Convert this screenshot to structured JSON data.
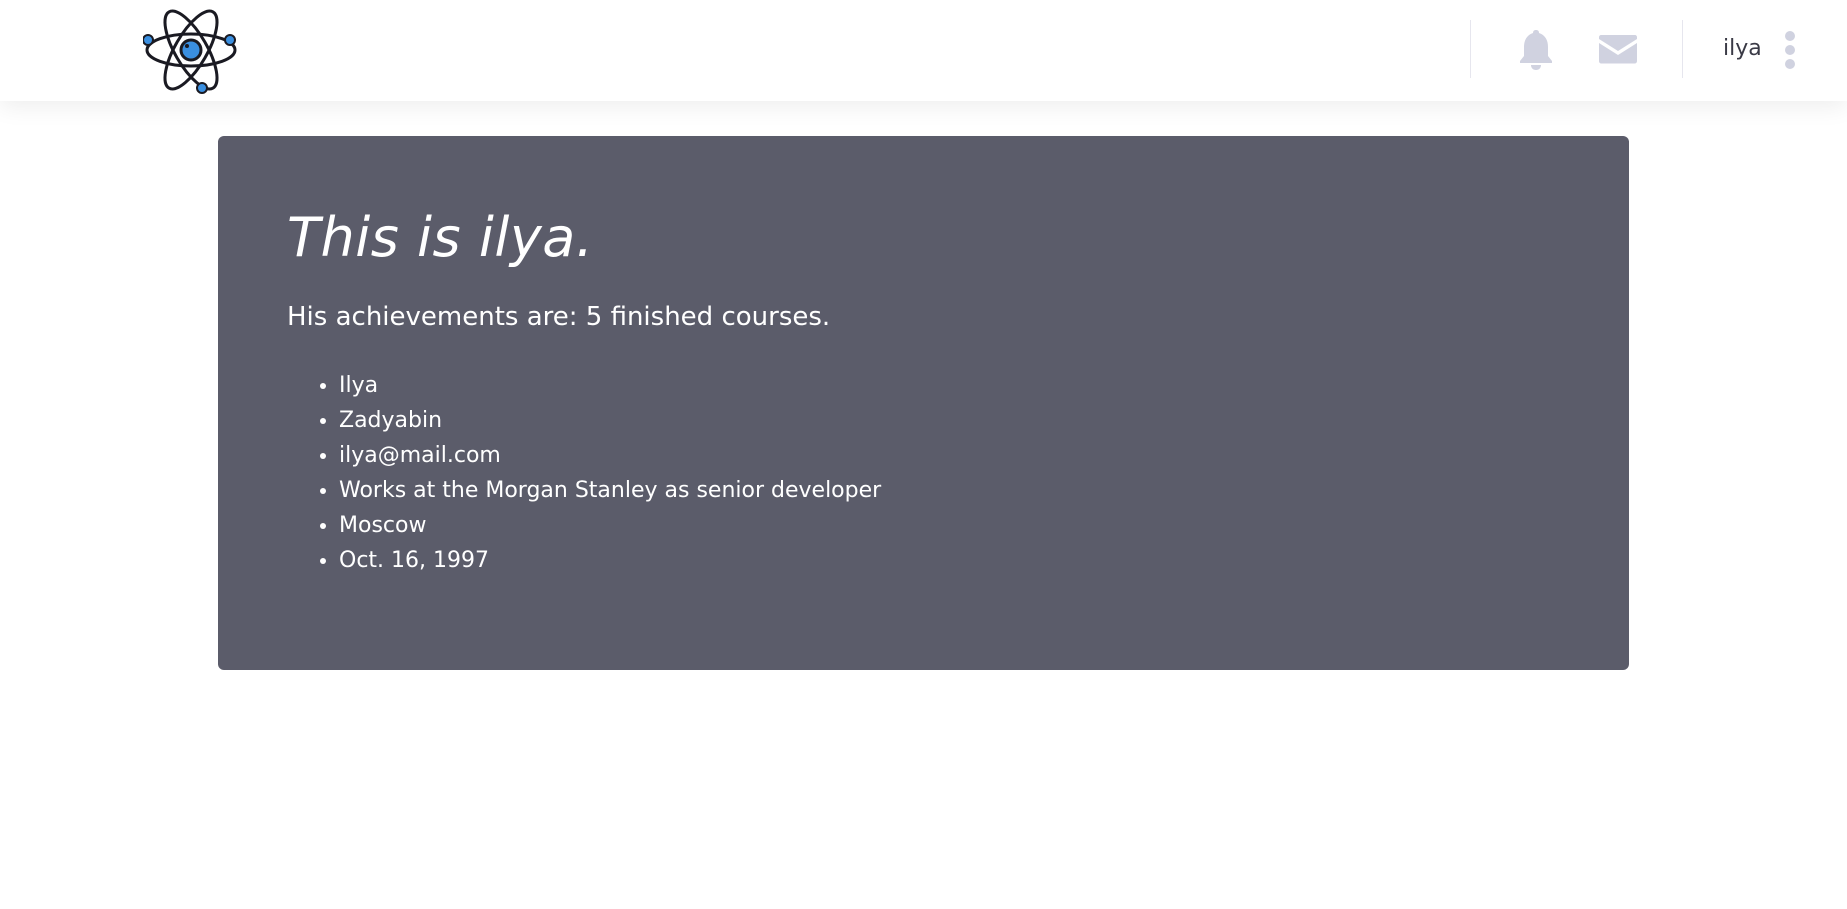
{
  "navbar": {
    "logo": "atom-logo",
    "icons": {
      "notifications": "bell-icon",
      "messages": "envelope-icon",
      "menu": "vertical-dots-icon"
    },
    "username": "ilya"
  },
  "profile": {
    "title": "This is ilya.",
    "achievements": "His achievements are: 5 finished courses.",
    "details": [
      "Ilya",
      "Zadyabin",
      "ilya@mail.com",
      "Works at the Morgan Stanley as senior developer",
      "Moscow",
      "Oct. 16, 1997"
    ]
  },
  "colors": {
    "card_background": "#5b5c6a",
    "nav_icon": "#d0d2e0",
    "logo_accent": "#3a8fe0"
  }
}
